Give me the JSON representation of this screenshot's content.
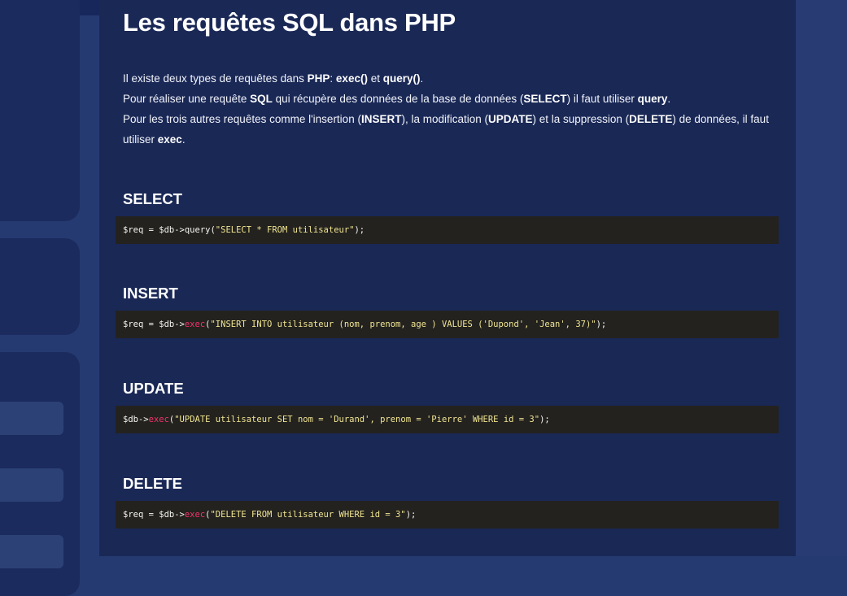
{
  "page": {
    "title": "Les requêtes SQL dans PHP"
  },
  "intro": {
    "line1": [
      "Il existe deux types de requêtes dans ",
      "PHP",
      ": ",
      "exec()",
      " et ",
      "query()",
      "."
    ],
    "line2": [
      "Pour réaliser une requête ",
      "SQL",
      " qui récupère des données de la base de données (",
      "SELECT",
      ") il faut utiliser ",
      "query",
      "."
    ],
    "line3": [
      "Pour les trois autres requêtes comme l'insertion (",
      "INSERT",
      "), la modification (",
      "UPDATE",
      ") et la suppression (",
      "DELETE",
      ") de données, il faut utiliser ",
      "exec",
      "."
    ]
  },
  "sections": [
    {
      "title": "SELECT",
      "code": {
        "prefix": "$req = $db->",
        "method": "query",
        "open": "(",
        "string": "\"SELECT * FROM utilisateur\"",
        "close": ");"
      }
    },
    {
      "title": "INSERT",
      "code": {
        "prefix": "$req = $db->",
        "method": "exec",
        "open": "(",
        "string": "\"INSERT INTO utilisateur (nom, prenom, age ) VALUES ('Dupond', 'Jean', 37)\"",
        "close": ");"
      }
    },
    {
      "title": "UPDATE",
      "code": {
        "prefix": "$db->",
        "method": "exec",
        "open": "(",
        "string": "\"UPDATE utilisateur SET nom = 'Durand', prenom = 'Pierre' WHERE id = 3\"",
        "close": ");"
      }
    },
    {
      "title": "DELETE",
      "code": {
        "prefix": "$req = $db->",
        "method": "exec",
        "open": "(",
        "string": "\"DELETE FROM utilisateur WHERE id = 3\"",
        "close": ");"
      }
    }
  ],
  "colors": {
    "page_background": "#1a2856",
    "side_background": "#263a72",
    "code_background": "#23221f",
    "code_string": "#f1e592",
    "code_exec_keyword": "#f2336a"
  }
}
